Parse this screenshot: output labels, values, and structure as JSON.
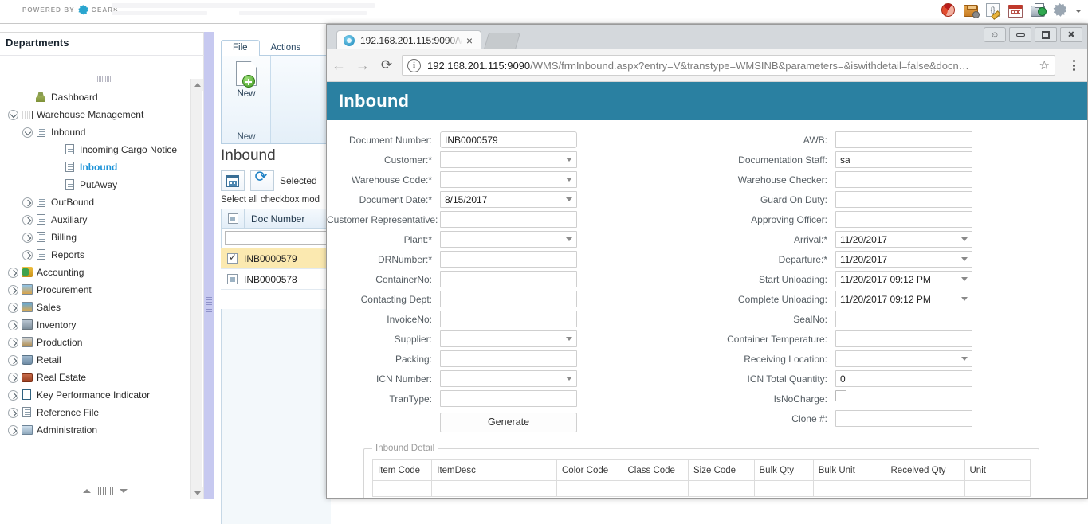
{
  "host_app": {
    "powered_by": "POWERED BY",
    "brand": "GEARS",
    "toolbar_icons": [
      "pie-chart-icon",
      "package-icon",
      "script-edit-icon",
      "calendar-icon",
      "print-preview-icon",
      "settings-icon",
      "overflow-caret-icon"
    ],
    "sidebar": {
      "title": "Departments",
      "items": [
        {
          "label": "Dashboard",
          "indent": 1,
          "expander": "none",
          "icon": "person-icon",
          "selected": false
        },
        {
          "label": "Warehouse Management",
          "indent": 0,
          "expander": "expanded",
          "icon": "warehouse-icon",
          "selected": false
        },
        {
          "label": "Inbound",
          "indent": 1,
          "expander": "expanded",
          "icon": "document-icon",
          "selected": false
        },
        {
          "label": "Incoming Cargo Notice",
          "indent": 3,
          "expander": "none",
          "icon": "document-icon",
          "selected": false
        },
        {
          "label": "Inbound",
          "indent": 3,
          "expander": "none",
          "icon": "document-icon",
          "selected": true
        },
        {
          "label": "PutAway",
          "indent": 3,
          "expander": "none",
          "icon": "document-icon",
          "selected": false
        },
        {
          "label": "OutBound",
          "indent": 1,
          "expander": "collapsed",
          "icon": "document-icon",
          "selected": false
        },
        {
          "label": "Auxiliary",
          "indent": 1,
          "expander": "collapsed",
          "icon": "document-icon",
          "selected": false
        },
        {
          "label": "Billing",
          "indent": 1,
          "expander": "collapsed",
          "icon": "document-icon",
          "selected": false
        },
        {
          "label": "Reports",
          "indent": 1,
          "expander": "collapsed",
          "icon": "document-icon",
          "selected": false
        },
        {
          "label": "Accounting",
          "indent": 0,
          "expander": "collapsed",
          "icon": "accounting-icon",
          "selected": false
        },
        {
          "label": "Procurement",
          "indent": 0,
          "expander": "collapsed",
          "icon": "procurement-icon",
          "selected": false
        },
        {
          "label": "Sales",
          "indent": 0,
          "expander": "collapsed",
          "icon": "sales-icon",
          "selected": false
        },
        {
          "label": "Inventory",
          "indent": 0,
          "expander": "collapsed",
          "icon": "inventory-icon",
          "selected": false
        },
        {
          "label": "Production",
          "indent": 0,
          "expander": "collapsed",
          "icon": "production-icon",
          "selected": false
        },
        {
          "label": "Retail",
          "indent": 0,
          "expander": "collapsed",
          "icon": "retail-cart-icon",
          "selected": false
        },
        {
          "label": "Real Estate",
          "indent": 0,
          "expander": "collapsed",
          "icon": "briefcase-icon",
          "selected": false
        },
        {
          "label": "Key Performance Indicator",
          "indent": 0,
          "expander": "collapsed",
          "icon": "building-icon",
          "selected": false
        },
        {
          "label": "Reference File",
          "indent": 0,
          "expander": "collapsed",
          "icon": "document-icon",
          "selected": false
        },
        {
          "label": "Administration",
          "indent": 0,
          "expander": "collapsed",
          "icon": "monitor-icon",
          "selected": false
        }
      ]
    },
    "list_panel": {
      "ribbon_tabs": [
        {
          "label": "File",
          "active": true
        },
        {
          "label": "Actions",
          "active": false
        }
      ],
      "new_button_label": "New",
      "new_group_caption": "New",
      "title": "Inbound",
      "calendar_button": "calendar-icon",
      "refresh_button": "refresh-icon",
      "selected_label": "Selected",
      "select_all_hint": "Select all checkbox mod",
      "grid": {
        "header_checkbox_state": "indeterminate",
        "columns": [
          "Doc Number"
        ],
        "filter_value": "",
        "rows": [
          {
            "doc_number": "INB0000579",
            "checked": true,
            "selected": true
          },
          {
            "doc_number": "INB0000578",
            "checked": false,
            "selected": false
          }
        ]
      }
    }
  },
  "browser": {
    "tab": {
      "title": "192.168.201.115:9090/W",
      "favicon": "gear-globe-icon",
      "close": "×"
    },
    "window_buttons": [
      "profile-icon",
      "minimize",
      "maximize",
      "close"
    ],
    "close_glyph": "✖",
    "nav": {
      "back": "←",
      "forward": "→",
      "reload": "⟳"
    },
    "omnibox": {
      "info_glyph": "i",
      "url_host": "192.168.201.115:9090",
      "url_rest": "/WMS/frmInbound.aspx?entry=V&transtype=WMSINB&parameters=&iswithdetail=false&docn…",
      "star": "☆"
    },
    "menu": "chrome-menu-icon"
  },
  "page": {
    "title": "Inbound",
    "header_color": "#2a80a1",
    "left_fields": [
      {
        "label": "Document Number:",
        "type": "text",
        "value": "INB0000579"
      },
      {
        "label": "Customer:*",
        "type": "select",
        "value": ""
      },
      {
        "label": "Warehouse Code:*",
        "type": "select",
        "value": ""
      },
      {
        "label": "Document Date:*",
        "type": "select",
        "value": "8/15/2017"
      },
      {
        "label": "Customer Representative:",
        "type": "text",
        "value": ""
      },
      {
        "label": "Plant:*",
        "type": "select",
        "value": ""
      },
      {
        "label": "DRNumber:*",
        "type": "text",
        "value": ""
      },
      {
        "label": "ContainerNo:",
        "type": "text",
        "value": ""
      },
      {
        "label": "Contacting Dept:",
        "type": "text",
        "value": ""
      },
      {
        "label": "InvoiceNo:",
        "type": "text",
        "value": ""
      },
      {
        "label": "Supplier:",
        "type": "select",
        "value": ""
      },
      {
        "label": "Packing:",
        "type": "text",
        "value": ""
      },
      {
        "label": "ICN Number:",
        "type": "select",
        "value": ""
      },
      {
        "label": "TranType:",
        "type": "text",
        "value": ""
      }
    ],
    "generate_button": "Generate",
    "right_fields": [
      {
        "label": "AWB:",
        "type": "text",
        "value": ""
      },
      {
        "label": "Documentation Staff:",
        "type": "text",
        "value": "sa"
      },
      {
        "label": "Warehouse Checker:",
        "type": "text",
        "value": ""
      },
      {
        "label": "Guard On Duty:",
        "type": "text",
        "value": ""
      },
      {
        "label": "Approving Officer:",
        "type": "text",
        "value": ""
      },
      {
        "label": "Arrival:*",
        "type": "select",
        "value": "11/20/2017"
      },
      {
        "label": "Departure:*",
        "type": "select",
        "value": "11/20/2017"
      },
      {
        "label": "Start Unloading:",
        "type": "select",
        "value": "11/20/2017 09:12 PM"
      },
      {
        "label": "Complete Unloading:",
        "type": "select",
        "value": "11/20/2017 09:12 PM"
      },
      {
        "label": "SealNo:",
        "type": "text",
        "value": ""
      },
      {
        "label": "Container Temperature:",
        "type": "text",
        "value": ""
      },
      {
        "label": "Receiving Location:",
        "type": "select",
        "value": ""
      },
      {
        "label": "ICN Total Quantity:",
        "type": "text",
        "value": "0"
      },
      {
        "label": "IsNoCharge:",
        "type": "checkbox",
        "value": false
      },
      {
        "label": "Clone #:",
        "type": "text",
        "value": ""
      }
    ],
    "detail": {
      "legend": "Inbound Detail",
      "columns": [
        "Item Code",
        "ItemDesc",
        "Color Code",
        "Class Code",
        "Size Code",
        "Bulk Qty",
        "Bulk Unit",
        "Received Qty",
        "Unit"
      ]
    }
  }
}
